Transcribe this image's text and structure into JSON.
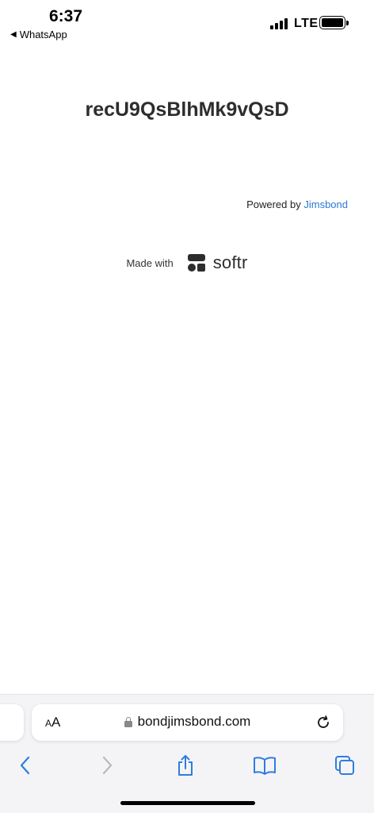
{
  "status_bar": {
    "time": "6:37",
    "back_app": "WhatsApp",
    "network": "LTE"
  },
  "page": {
    "title": "recU9QsBlhMk9vQsD",
    "powered_prefix": "Powered by",
    "powered_link": "Jimsbond",
    "made_with_label": "Made with",
    "brand_word": "softr"
  },
  "safari": {
    "aa_small": "A",
    "aa_big": "A",
    "url": "bondjimsbond.com"
  },
  "colors": {
    "link": "#2a7ad6",
    "toolbar_icon_active": "#2f7de1",
    "toolbar_icon_disabled": "#b9b9bd"
  },
  "icons": {
    "back": "chevron-left-icon",
    "forward": "chevron-right-icon",
    "share": "share-icon",
    "bookmarks": "book-icon",
    "tabs": "tabs-icon",
    "reload": "reload-icon",
    "lock": "lock-icon"
  }
}
